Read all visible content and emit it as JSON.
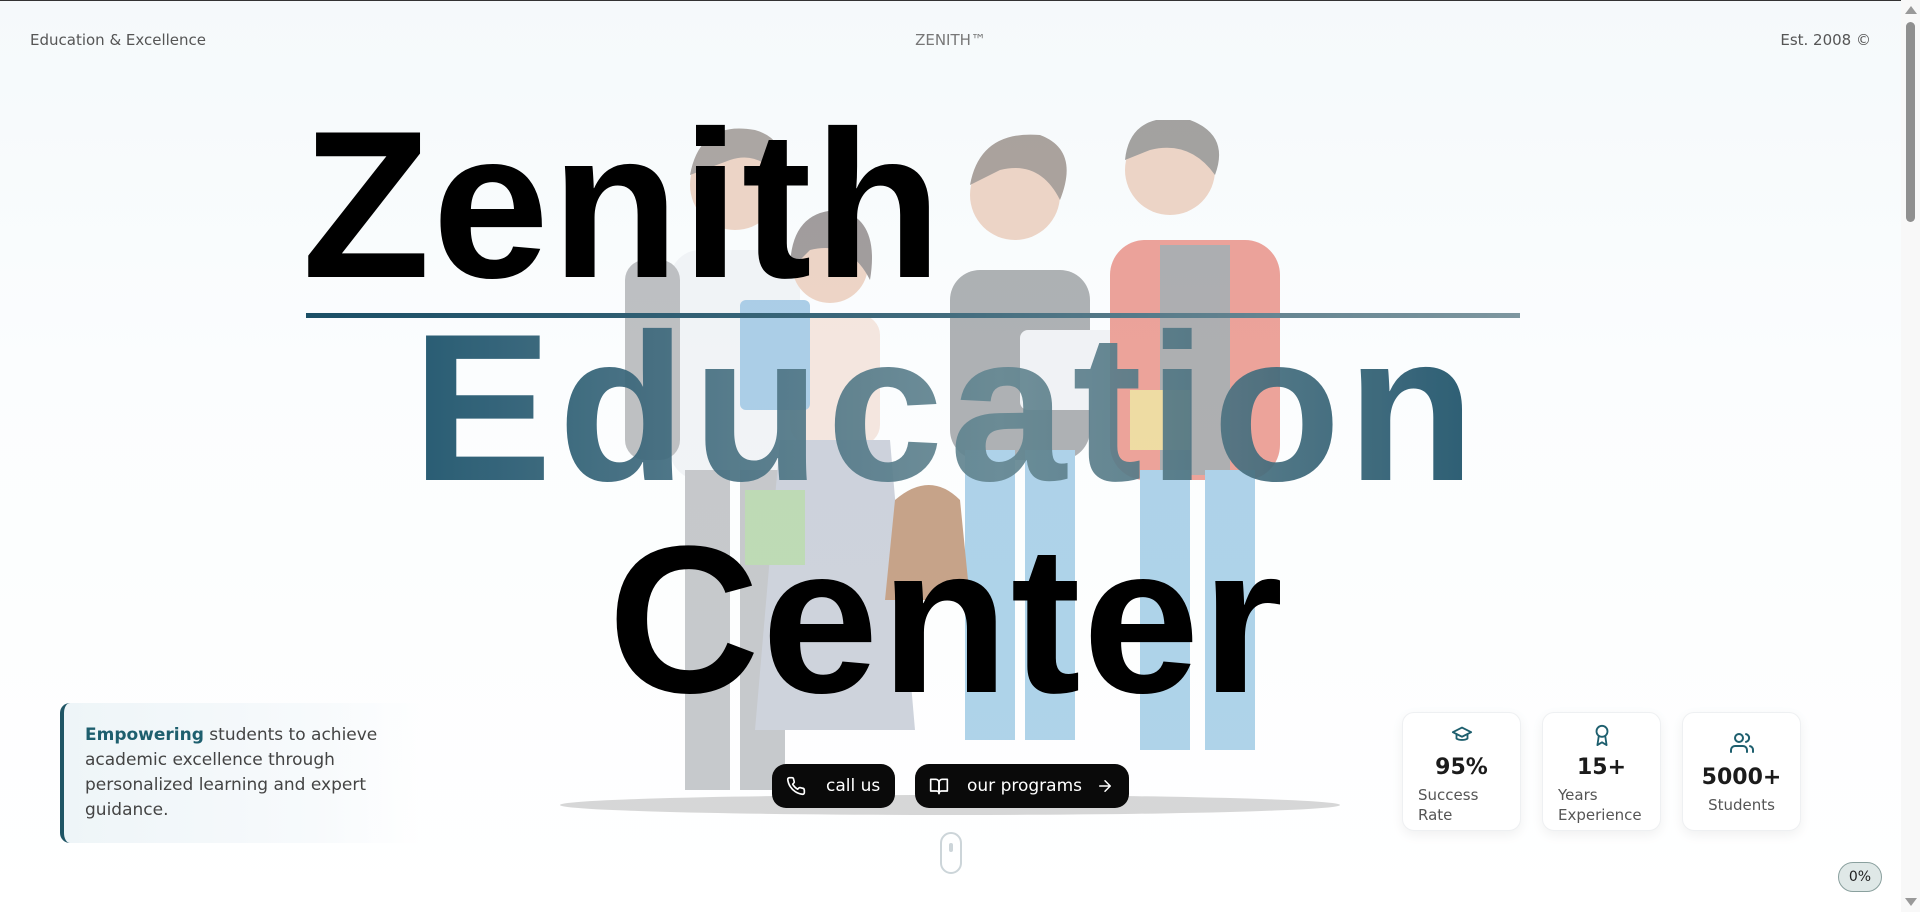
{
  "header": {
    "left": "Education & Excellence",
    "center": "ZENITH™",
    "right": "Est. 2008 ©"
  },
  "hero": {
    "line1": "Zenith",
    "line2": "Education",
    "line3": "Center"
  },
  "callout": {
    "highlight": "Empowering",
    "rest": " students to achieve academic excellence through personalized learning and expert guidance."
  },
  "cta": {
    "call_label": "call us",
    "programs_label": "our programs"
  },
  "stats": [
    {
      "value": "95%",
      "label": "Success Rate",
      "icon": "graduation-cap-icon"
    },
    {
      "value": "15+",
      "label": "Years Experience",
      "icon": "award-icon"
    },
    {
      "value": "5000+",
      "label": "Students",
      "icon": "users-icon"
    }
  ],
  "progress": "0%",
  "colors": {
    "accent": "#1e5f6e",
    "dark": "#0a0a0a"
  }
}
